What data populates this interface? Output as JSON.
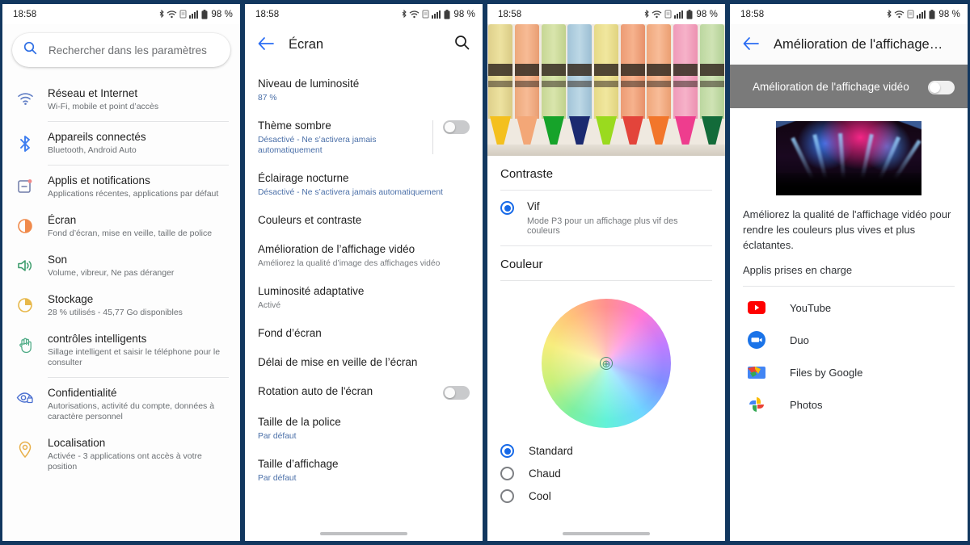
{
  "backdrop_color": "#1a4680",
  "statusbar": {
    "time": "18:58",
    "battery_pct": "98 %",
    "icons": [
      "bluetooth-icon",
      "wifi-icon",
      "sim-icon",
      "signal-icon",
      "battery-icon"
    ]
  },
  "panel1": {
    "name": "settings-home",
    "search": {
      "placeholder": "Rechercher dans les paramètres",
      "icon": "search-icon"
    },
    "items": [
      {
        "icon": "wifi-icon",
        "icon_color": "#5e7cc4",
        "title": "Réseau et Internet",
        "subtitle": "Wi-Fi, mobile et point d’accès",
        "divider_after": true
      },
      {
        "icon": "bluetooth-icon",
        "icon_color": "#3d7df0",
        "title": "Appareils connectés",
        "subtitle": "Bluetooth, Android Auto",
        "divider_after": true
      },
      {
        "icon": "apps-icon",
        "icon_color": "#6e7ba8",
        "title": "Applis et notifications",
        "subtitle": "Applications récentes, applications par défaut",
        "divider_after": false
      },
      {
        "icon": "display-icon",
        "icon_color": "#f08a4b",
        "title": "Écran",
        "subtitle": "Fond d’écran, mise en veille, taille de police",
        "divider_after": false
      },
      {
        "icon": "sound-icon",
        "icon_color": "#3f9e6e",
        "title": "Son",
        "subtitle": "Volume, vibreur, Ne pas déranger",
        "divider_after": false
      },
      {
        "icon": "storage-icon",
        "icon_color": "#e7b84b",
        "title": "Stockage",
        "subtitle": "28 % utilisés - 45,77 Go disponibles",
        "divider_after": false
      },
      {
        "icon": "hand-icon",
        "icon_color": "#4eab86",
        "title": "contrôles intelligents",
        "subtitle": "Sillage intelligent et saisir le téléphone pour le consulter",
        "divider_after": true
      },
      {
        "icon": "privacy-icon",
        "icon_color": "#4a6fd0",
        "title": "Confidentialité",
        "subtitle": "Autorisations, activité du compte, données à caractère personnel",
        "divider_after": false
      },
      {
        "icon": "location-icon",
        "icon_color": "#e8b04a",
        "title": "Localisation",
        "subtitle": "Activée - 3 applications ont accès à votre position",
        "divider_after": false
      }
    ]
  },
  "panel2": {
    "name": "display-settings",
    "appbar": {
      "back_icon": "back-arrow-icon",
      "title": "Écran",
      "search_icon": "search-icon"
    },
    "rows": [
      {
        "title": "Niveau de luminosité",
        "subtitle": "87 %",
        "subtitle_style": "blue",
        "control": "none"
      },
      {
        "title": "Thème sombre",
        "subtitle": "Désactivé - Ne s’activera jamais automatiquement",
        "subtitle_style": "blue",
        "control": "toggle",
        "toggle_on": false,
        "separator": true
      },
      {
        "title": "Éclairage nocturne",
        "subtitle": "Désactivé - Ne s’activera jamais automatiquement",
        "subtitle_style": "blue",
        "control": "none"
      },
      {
        "title": "Couleurs et contraste",
        "subtitle": "",
        "subtitle_style": "none",
        "control": "none"
      },
      {
        "title": "Amélioration de l’affichage vidéo",
        "subtitle": "Améliorez la qualité d’image des affichages vidéo",
        "subtitle_style": "grey",
        "control": "none"
      },
      {
        "title": "Luminosité adaptative",
        "subtitle": "Activé",
        "subtitle_style": "grey",
        "control": "none"
      },
      {
        "title": "Fond d’écran",
        "subtitle": "",
        "subtitle_style": "none",
        "control": "none"
      },
      {
        "title": "Délai de mise en veille de l’écran",
        "subtitle": "",
        "subtitle_style": "none",
        "control": "none"
      },
      {
        "title": "Rotation auto de l'écran",
        "subtitle": "",
        "subtitle_style": "none",
        "control": "toggle",
        "toggle_on": false
      },
      {
        "title": "Taille de la police",
        "subtitle": "Par défaut",
        "subtitle_style": "blue",
        "control": "none"
      },
      {
        "title": "Taille d’affichage",
        "subtitle": "Par défaut",
        "subtitle_style": "blue",
        "control": "none"
      }
    ]
  },
  "panel3": {
    "name": "colors-and-contrast",
    "hero_image": "crayons-photo",
    "crayon_colors": [
      "#e8d98a",
      "#f0ab7e",
      "#cfdc9a",
      "#a9c9da",
      "#ece08a",
      "#ef9f77",
      "#f2a97d",
      "#f0a0bd",
      "#bedaa3"
    ],
    "crayon_tip_colors": [
      "#f4c01e",
      "#f3a777",
      "#16a32a",
      "#1b2a70",
      "#9ada1e",
      "#e3443b",
      "#f2762b",
      "#ee3d8e",
      "#136b3a"
    ],
    "contrast": {
      "section_title": "Contraste",
      "options": [
        {
          "label": "Vif",
          "description": "Mode P3 pour un affichage plus vif des couleurs",
          "selected": true
        }
      ]
    },
    "color": {
      "section_title": "Couleur",
      "wheel_cursor_icon": "crosshair-icon",
      "options": [
        {
          "label": "Standard",
          "selected": true
        },
        {
          "label": "Chaud",
          "selected": false
        },
        {
          "label": "Cool",
          "selected": false
        }
      ]
    }
  },
  "panel4": {
    "name": "video-enhancer",
    "appbar": {
      "back_icon": "back-arrow-icon",
      "title": "Amélioration de l'affichage…"
    },
    "banner": {
      "label": "Amélioration de l'affichage vidéo",
      "toggle_on": false,
      "bg_color": "#7a7a7a"
    },
    "preview_image": "concert-stage-photo",
    "description": "Améliorez la qualité de l'affichage vidéo pour rendre les couleurs plus vives et plus éclatantes.",
    "apps_heading": "Applis prises en charge",
    "apps": [
      {
        "icon": "youtube-icon",
        "label": "YouTube"
      },
      {
        "icon": "duo-icon",
        "label": "Duo"
      },
      {
        "icon": "files-by-google-icon",
        "label": "Files by Google"
      },
      {
        "icon": "google-photos-icon",
        "label": "Photos"
      }
    ]
  }
}
